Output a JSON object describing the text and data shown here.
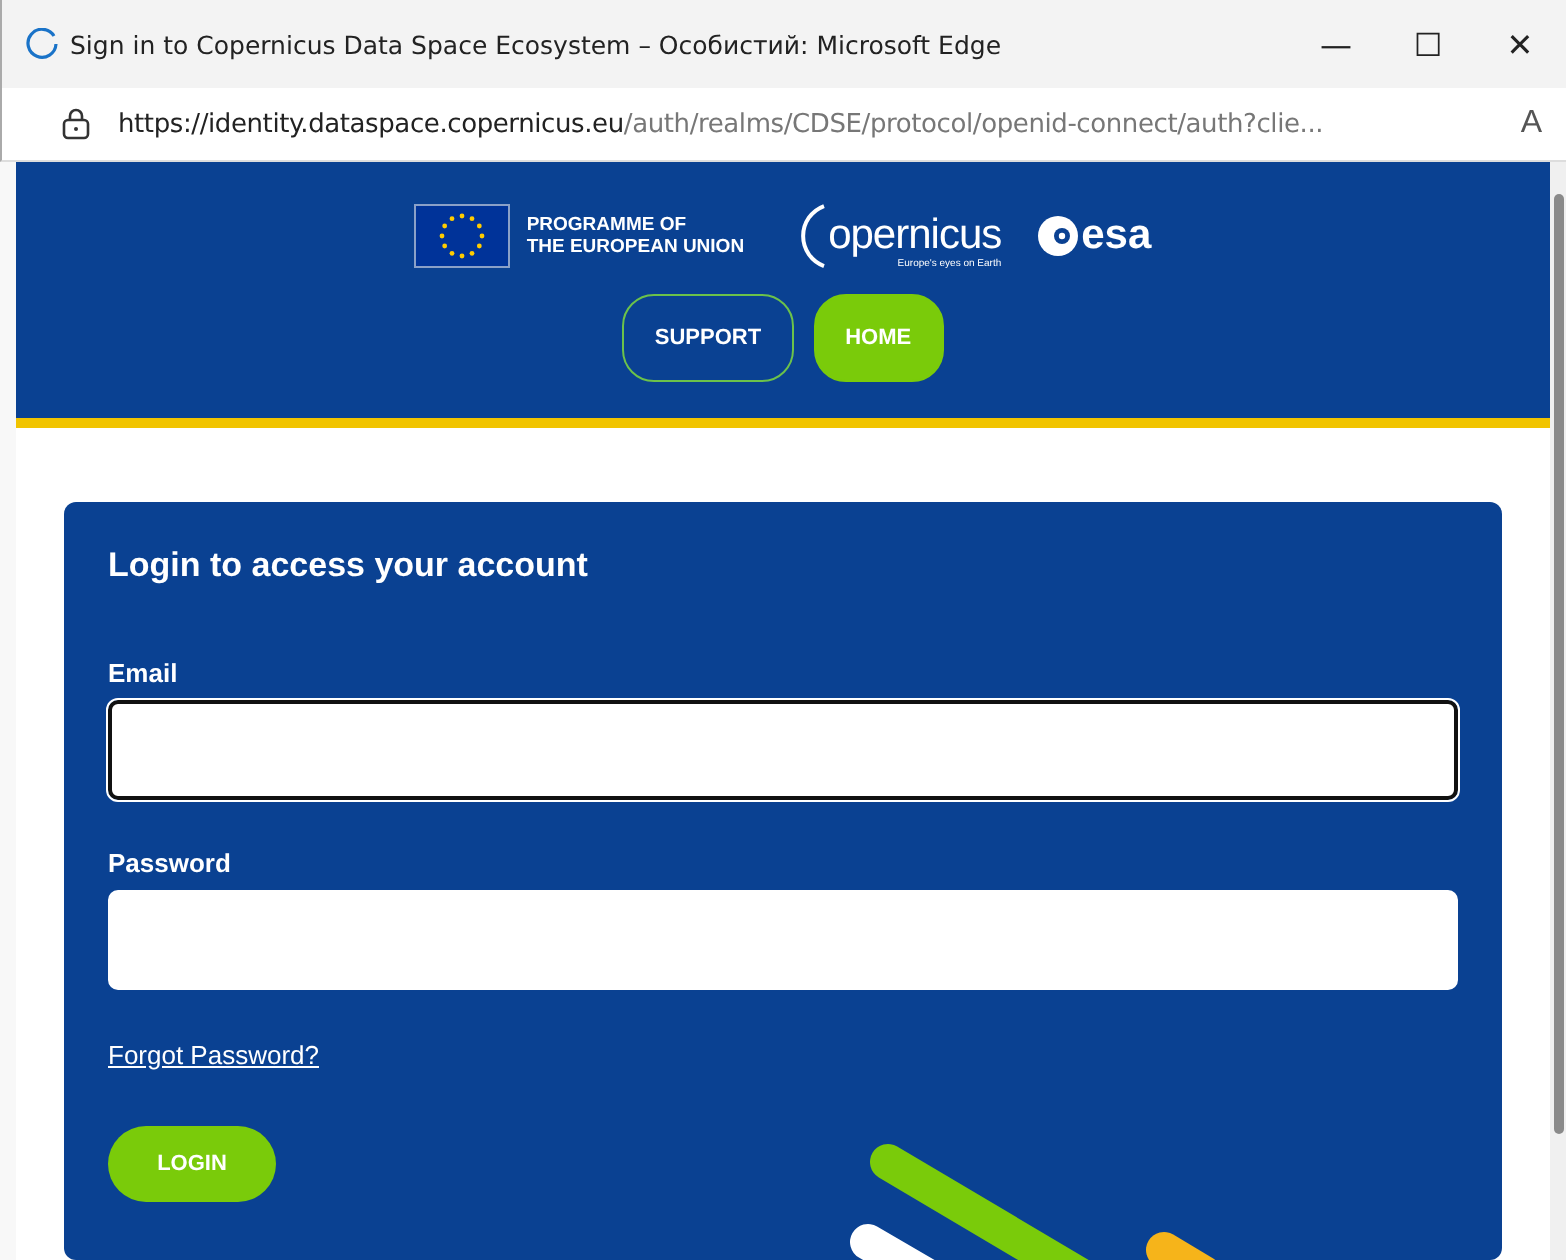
{
  "window": {
    "title": "Sign in to Copernicus Data Space Ecosystem – Особистий: Microsoft Edge",
    "controls": [
      "—",
      "☐",
      "✕"
    ]
  },
  "address_bar": {
    "host": "https://identity.dataspace.copernicus.eu",
    "path": "/auth/realms/CDSE/protocol/openid-connect/auth?clie...",
    "reader": "A"
  },
  "header": {
    "eu_text": [
      "PROGRAMME OF",
      "THE EUROPEAN UNION"
    ],
    "copernicus": {
      "wordmark": "opernicus",
      "tagline": "Europe's eyes on Earth"
    },
    "esa": "esa",
    "nav": [
      {
        "label": "SUPPORT",
        "selected": false
      },
      {
        "label": "HOME",
        "selected": true
      }
    ]
  },
  "login": {
    "title": "Login to access your account",
    "fields": [
      {
        "label": "Email",
        "focused": true
      },
      {
        "label": "Password",
        "focused": false
      }
    ],
    "forgot": "Forgot Password?",
    "button": "LOGIN"
  }
}
